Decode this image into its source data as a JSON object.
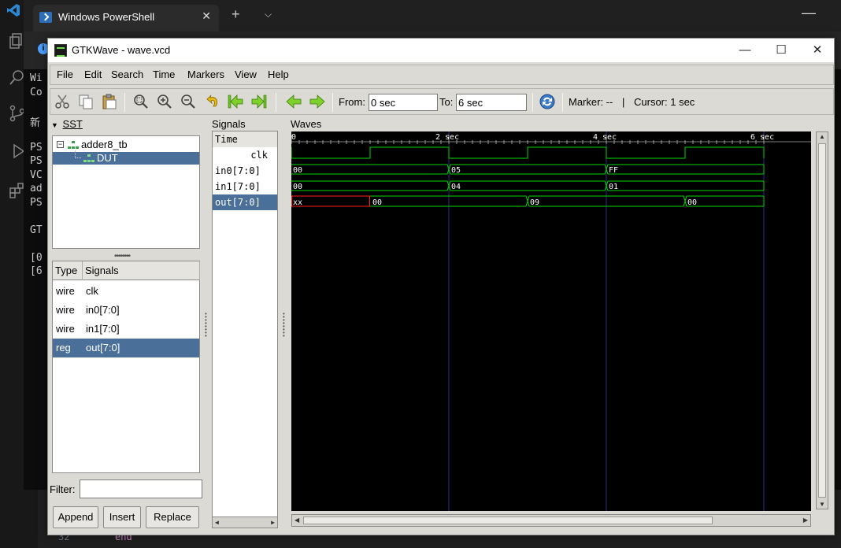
{
  "powershell": {
    "tab_title": "Windows PowerShell",
    "new_tab": "+",
    "close": "✕",
    "dropdown": "⌵",
    "console_lines": [
      "Wi",
      "Co",
      "",
      "新",
      "",
      "PS",
      "PS",
      "VC",
      "ad",
      "PS",
      "",
      "GT",
      "",
      "[0",
      "[6"
    ]
  },
  "vscode": {
    "line_number": "32",
    "code_keyword": "end"
  },
  "gtkwave": {
    "title": "GTKWave - wave.vcd",
    "menu": [
      "File",
      "Edit",
      "Search",
      "Time",
      "Markers",
      "View",
      "Help"
    ],
    "toolbar": {
      "from_label": "From:",
      "from_value": "0 sec",
      "to_label": "To:",
      "to_value": "6 sec",
      "marker_label": "Marker: --",
      "separator": "|",
      "cursor_label": "Cursor: 1 sec"
    },
    "sst": {
      "title": "SST",
      "tree": [
        {
          "label": "adder8_tb",
          "expanded": true
        },
        {
          "label": "DUT",
          "selected": true
        }
      ],
      "columns": {
        "type": "Type",
        "signals": "Signals"
      },
      "rows": [
        {
          "type": "wire",
          "name": "clk"
        },
        {
          "type": "wire",
          "name": "in0[7:0]"
        },
        {
          "type": "wire",
          "name": "in1[7:0]"
        },
        {
          "type": "reg",
          "name": "out[7:0]",
          "selected": true
        }
      ],
      "filter_label": "Filter:",
      "filter_value": "",
      "buttons": {
        "append": "Append",
        "insert": "Insert",
        "replace": "Replace"
      }
    },
    "signals_pane": {
      "title": "Signals",
      "time_label": "Time",
      "signals": [
        "clk",
        "in0[7:0]",
        "in1[7:0]",
        "out[7:0]"
      ]
    },
    "waves_pane": {
      "title": "Waves",
      "tick_labels": [
        "0",
        "2 sec",
        "4 sec",
        "6 sec"
      ],
      "in0_values": [
        "00",
        "05",
        "FF"
      ],
      "in1_values": [
        "00",
        "04",
        "01"
      ],
      "out_values": [
        "xx",
        "00",
        "09",
        "00"
      ],
      "colors": {
        "background": "#000000",
        "signal": "#00e000",
        "undefined": "#ff2020",
        "grid": "#3030a0",
        "text": "#ffffff"
      }
    }
  }
}
